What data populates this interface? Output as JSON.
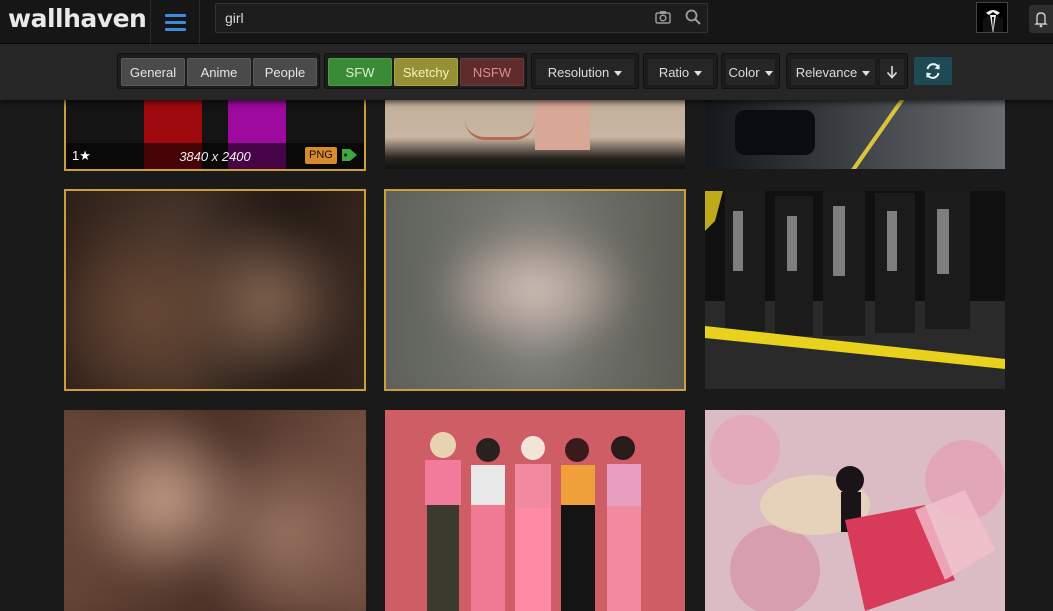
{
  "header": {
    "logo": "wallhaven",
    "search_value": "girl",
    "search_placeholder": ""
  },
  "filters": {
    "categories": [
      "General",
      "Anime",
      "People"
    ],
    "purity": {
      "sfw": "SFW",
      "sketchy": "Sketchy",
      "nsfw": "NSFW"
    },
    "resolution": "Resolution",
    "ratio": "Ratio",
    "color": "Color",
    "sort": "Relevance"
  },
  "thumbnails": {
    "first": {
      "favorites": "1",
      "resolution": "3840 x 2400",
      "format": "PNG"
    }
  },
  "colors": {
    "accent_blue": "#3a8cdc",
    "selection_gold": "#cc9f3b",
    "sfw_green": "#3b8a36",
    "sketchy_yellow": "#959035",
    "nsfw_red": "#5e2c2c",
    "refresh_teal": "#1e4a56"
  },
  "icons": [
    "menu-icon",
    "camera-icon",
    "search-icon",
    "bell-icon",
    "caret-down-icon",
    "sort-order-down-icon",
    "refresh-icon",
    "star-icon",
    "tag-icon"
  ]
}
